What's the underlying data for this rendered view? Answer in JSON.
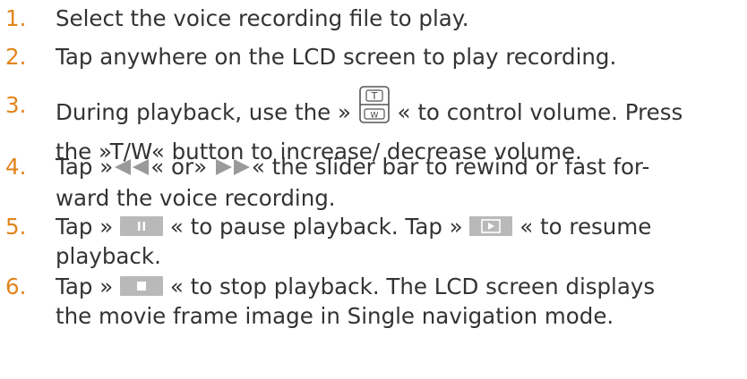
{
  "heading_fragment": "",
  "steps": [
    {
      "num": "1.",
      "lines": [
        "Select the voice recording file to play."
      ]
    },
    {
      "num": "2.",
      "lines": [
        "Tap anywhere on the LCD screen to play recording."
      ]
    },
    {
      "num": "3.",
      "parts": {
        "a": "During playback, use the »",
        "b": "« to control volume. Press",
        "c": "the »T/W« button to increase/ decrease volume."
      }
    },
    {
      "num": "4.",
      "parts": {
        "a": "Tap »",
        "b": "« or»",
        "c": "« the slider bar to rewind or fast for-",
        "d": "ward the voice recording."
      }
    },
    {
      "num": "5.",
      "parts": {
        "a": "Tap »",
        "b": "« to pause playback. Tap »",
        "c": "« to resume",
        "d": "playback."
      }
    },
    {
      "num": "6.",
      "parts": {
        "a": "Tap »",
        "b": "« to stop playback. The LCD screen displays",
        "c": "the movie frame image in Single navigation mode."
      }
    }
  ],
  "icons": {
    "zoom_tw": "zoom-tw-rocker-icon",
    "rewind": "rewind-icon",
    "fast_forward": "fast-forward-icon",
    "pause": "pause-icon",
    "play": "play-icon",
    "stop": "stop-icon"
  },
  "colors": {
    "step_number": "#e2841c",
    "text": "#333333",
    "button_grey": "#b9b9b9"
  }
}
